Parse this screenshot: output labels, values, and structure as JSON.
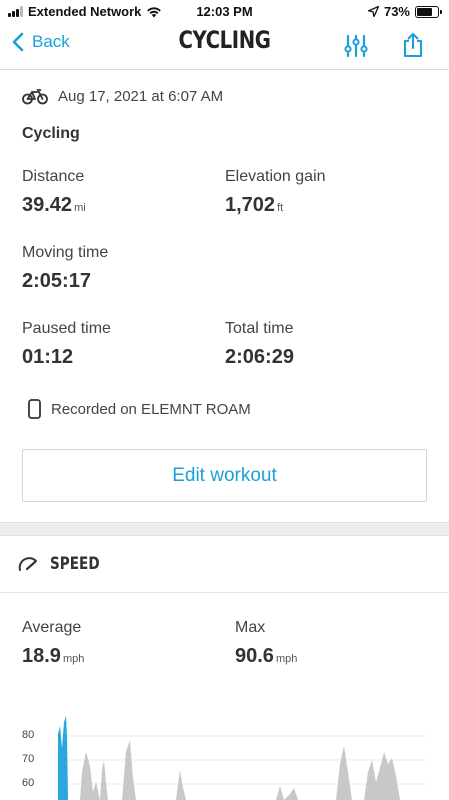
{
  "status_bar": {
    "carrier": "Extended Network",
    "time": "12:03 PM",
    "battery": "73%"
  },
  "nav": {
    "back_label": "Back",
    "title": "CYCLING"
  },
  "summary": {
    "date": "Aug 17, 2021 at 6:07 AM",
    "activity": "Cycling",
    "distance": {
      "label": "Distance",
      "value": "39.42",
      "unit": "mi"
    },
    "elevation": {
      "label": "Elevation gain",
      "value": "1,702",
      "unit": "ft"
    },
    "moving_time": {
      "label": "Moving time",
      "value": "2:05:17"
    },
    "paused_time": {
      "label": "Paused time",
      "value": "01:12"
    },
    "total_time": {
      "label": "Total time",
      "value": "2:06:29"
    },
    "device": "Recorded on ELEMNT ROAM",
    "edit_label": "Edit workout"
  },
  "speed": {
    "title": "SPEED",
    "average": {
      "label": "Average",
      "value": "18.9",
      "unit": "mph"
    },
    "max": {
      "label": "Max",
      "value": "90.6",
      "unit": "mph"
    }
  },
  "chart_data": {
    "type": "area",
    "y_ticks": [
      "80",
      "70",
      "60"
    ],
    "colors": {
      "highlight": "#2aa7dd",
      "series": "#c8c8c8"
    }
  },
  "colors": {
    "accent": "#1aa0d8"
  }
}
